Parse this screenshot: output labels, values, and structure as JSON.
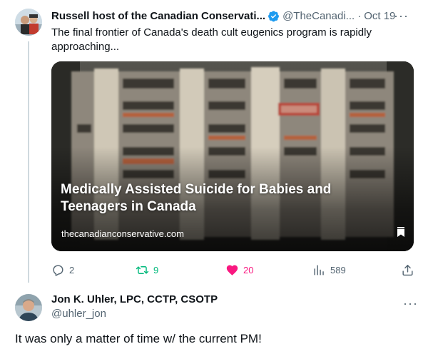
{
  "tweet": {
    "author_name": "Russell host of the Canadian Conservati...",
    "handle": "@TheCanadi...",
    "separator": "·",
    "time": "Oct 19",
    "more": "···",
    "text": "The final frontier of Canada's death cult eugenics program is rapidly approaching...",
    "card": {
      "title": "Medically Assisted Suicide for Babies and Teenagers in Canada",
      "domain": "thecanadianconservative.com"
    },
    "actions": {
      "replies": "2",
      "reposts": "9",
      "likes": "20",
      "views": "589"
    }
  },
  "reply": {
    "author_name": "Jon K. Uhler, LPC, CCTP, CSOTP",
    "handle": "@uhler_jon",
    "more": "···",
    "text": "It was only a matter of time w/ the current PM!"
  },
  "colors": {
    "verified": "#1d9bf0",
    "repost": "#00ba7c",
    "like": "#f91880",
    "muted": "#536471"
  },
  "icons": [
    "verified-icon",
    "more-icon",
    "reply-icon",
    "repost-icon",
    "heart-icon",
    "views-icon",
    "share-icon",
    "bookmark-icon"
  ]
}
